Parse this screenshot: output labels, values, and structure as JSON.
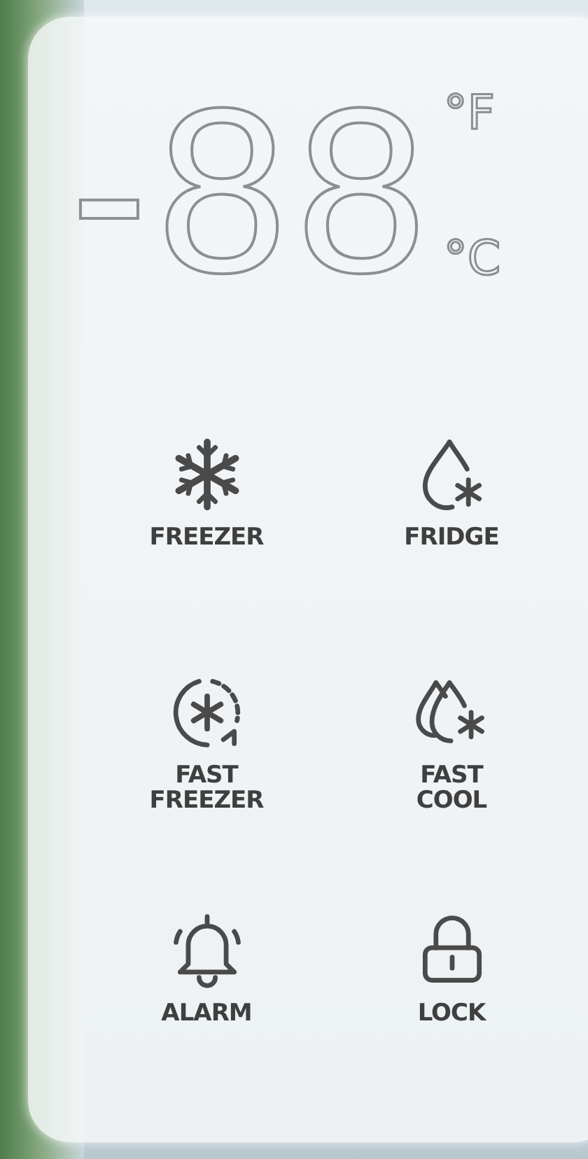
{
  "display": {
    "readout": "-88",
    "units": [
      "°F",
      "°C"
    ]
  },
  "buttons": [
    {
      "kind": "freezer",
      "label": "FREEZER"
    },
    {
      "kind": "fridge",
      "label": "FRIDGE"
    },
    {
      "kind": "fast-freezer",
      "label": "FAST FREEZER"
    },
    {
      "kind": "fast-cool",
      "label": "FAST COOL"
    },
    {
      "kind": "alarm",
      "label": "ALARM"
    },
    {
      "kind": "lock",
      "label": "LOCK"
    }
  ]
}
